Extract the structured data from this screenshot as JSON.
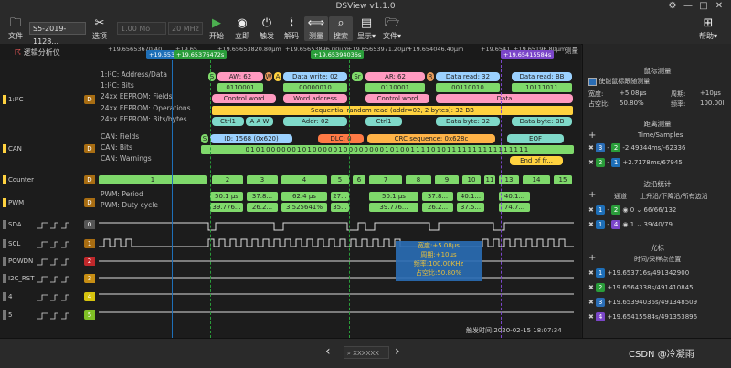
{
  "window": {
    "title": "DSView v1.1.0",
    "controls": [
      "⚙",
      "—",
      "□",
      "✕"
    ]
  },
  "toolbar": {
    "file": "文件",
    "device": "S5-2019-1128...",
    "options": "选项",
    "sample_count": "1.00 Mo",
    "sample_rate": "20 MHz",
    "start": "开始",
    "instant": "立即",
    "trigger": "触发",
    "decode": "解码",
    "measure": "测量",
    "search": "搜索",
    "display": "显示▾",
    "file2": "文件▾",
    "help": "帮助▾"
  },
  "ruler": {
    "ticks": [
      "+19.65653670.40",
      "+19.65",
      "+19.65653820.80μm",
      "+19.65653896.00μm",
      "+19.65653971.20μm",
      "+19.654046.40μm",
      "+19.6541",
      "+19.65196.80μm"
    ],
    "label": "测量",
    "markers": [
      "+19.6537",
      "+19.65376472s",
      "+19.65394036s",
      "+19.65415584s"
    ],
    "marker_colors": [
      "#1e6fb8",
      "#2a9d3a",
      "#2a9d3a",
      "#7b46c9"
    ]
  },
  "logo_label": "逻辑分析仪",
  "channels": {
    "i2c_label": "1:I²C",
    "i2c_badge": "D",
    "can_label": "CAN",
    "can_badge": "D",
    "counter_label": "Counter",
    "counter_badge": "D",
    "pwm_label": "PWM",
    "pwm_badge": "D",
    "sda": "SDA",
    "sda_n": "0",
    "scl": "SCL",
    "scl_n": "1",
    "powdn": "POWDN",
    "powdn_n": "2",
    "i2c_rst": "I2C_RST",
    "i2c_rst_n": "3",
    "ch4": "4",
    "ch4_n": "4",
    "ch5": "5",
    "ch5_n": "5"
  },
  "rows": {
    "r1": "1:I²C: Address/Data",
    "r2": "1:I²C: Bits",
    "r3": "24xx EEPROM: Fields",
    "r4": "24xx EEPROM: Operations",
    "r5": "24xx EEPROM: Bits/bytes",
    "r6": "CAN: Fields",
    "r7": "CAN: Bits",
    "r8": "CAN: Warnings",
    "r9": "PWM: Period",
    "r10": "PWM: Duty cycle"
  },
  "segs": {
    "aw62": "AW: 62",
    "dw02": "Data write: 02",
    "ar62": "AR: 62",
    "dr32": "Data read: 32",
    "drbb": "Data read: BB",
    "s": "S",
    "w": "W",
    "a": "A",
    "sr": "Sr",
    "r": "R",
    "p": "P",
    "bits1": "0110001",
    "bits2": "00000010",
    "bits3": "0110001",
    "bits4": "00110010",
    "bits5": "10111011",
    "cw": "Control word",
    "wa": "Word address",
    "cw2": "Control word",
    "data": "Data",
    "seq": "Sequential random read (addr=02, 2 bytes): 32 BB",
    "ctrl1": "Ctrl1",
    "aaw": "A A W",
    "addr02": "Addr: 02",
    "ctrl2": "Ctrl1",
    "db32": "Data byte: 32",
    "dbbb": "Data byte: BB",
    "id": "ID: 1568 (0x620)",
    "dlc": "DLC: 0",
    "crc": "CRC sequence: 0x628c",
    "eof": "EOF",
    "can_bits": "0101000000101000001000000001010011110101111111111111111",
    "eofr": "End of fr...",
    "pwm_period": [
      "50.1 μs",
      "37.8...",
      "62.4 μs",
      "27...",
      "50.1 μs",
      "37.8...",
      "40.1...",
      "40.1..."
    ],
    "pwm_duty": [
      "39.776...",
      "26.2...",
      "3.525641%",
      "35...",
      "39.776...",
      "26.2...",
      "37.5...",
      "74.7..."
    ],
    "counter": [
      "1",
      "2",
      "3",
      "4",
      "5",
      "6",
      "7",
      "8",
      "9",
      "10",
      "11",
      "13",
      "14",
      "15"
    ]
  },
  "measure_box": [
    "宽度:+5.08μs",
    "周期:+10μs",
    "频率:100.00KHz",
    "占空比:50.80%"
  ],
  "panel": {
    "cursor_measure": "鼠标测量",
    "enable_follow": "使能鼠标跟随测量",
    "width_lbl": "宽度:",
    "width": "+5.08μs",
    "period_lbl": "周期:",
    "period": "+10μs",
    "duty_lbl": "占空比:",
    "duty": "50.80%",
    "freq_lbl": "频率:",
    "freq": "100.00l",
    "distance": "距离测量",
    "time_samples": "Time/Samples",
    "d1": "-2.49344ms/-62336",
    "d2": "+2.7178ms/67945",
    "edge": "边沿统计",
    "channel": "通道",
    "edge_hdr": "上升沿/下降沿/所有边沿",
    "e1": "66/66/132",
    "e2": "39/40/79",
    "cursor": "光标",
    "cursor_hdr": "时间/采样点位置",
    "c1": "+19.653716s/491342900",
    "c2": "+19.6564338s/491410845",
    "c3": "+19.65394036s/491348509",
    "c4": "+19.65415584s/491353896",
    "plus": "+",
    "close": "✖",
    "dash": "-",
    "n1": "1",
    "n2": "2",
    "n3": "3",
    "n4": "4",
    "n0": "0",
    "colors": {
      "c1": "#1e6fb8",
      "c2": "#2a9d3a",
      "c3": "#2a6db5",
      "c4": "#7b46c9"
    }
  },
  "status": {
    "trigger_time": "触发时间:2020-02-15 18:07:34",
    "nav_prev": "‹",
    "nav_next": "›",
    "search": "XXXXXX",
    "csdn": "CSDN @冷凝雨"
  }
}
